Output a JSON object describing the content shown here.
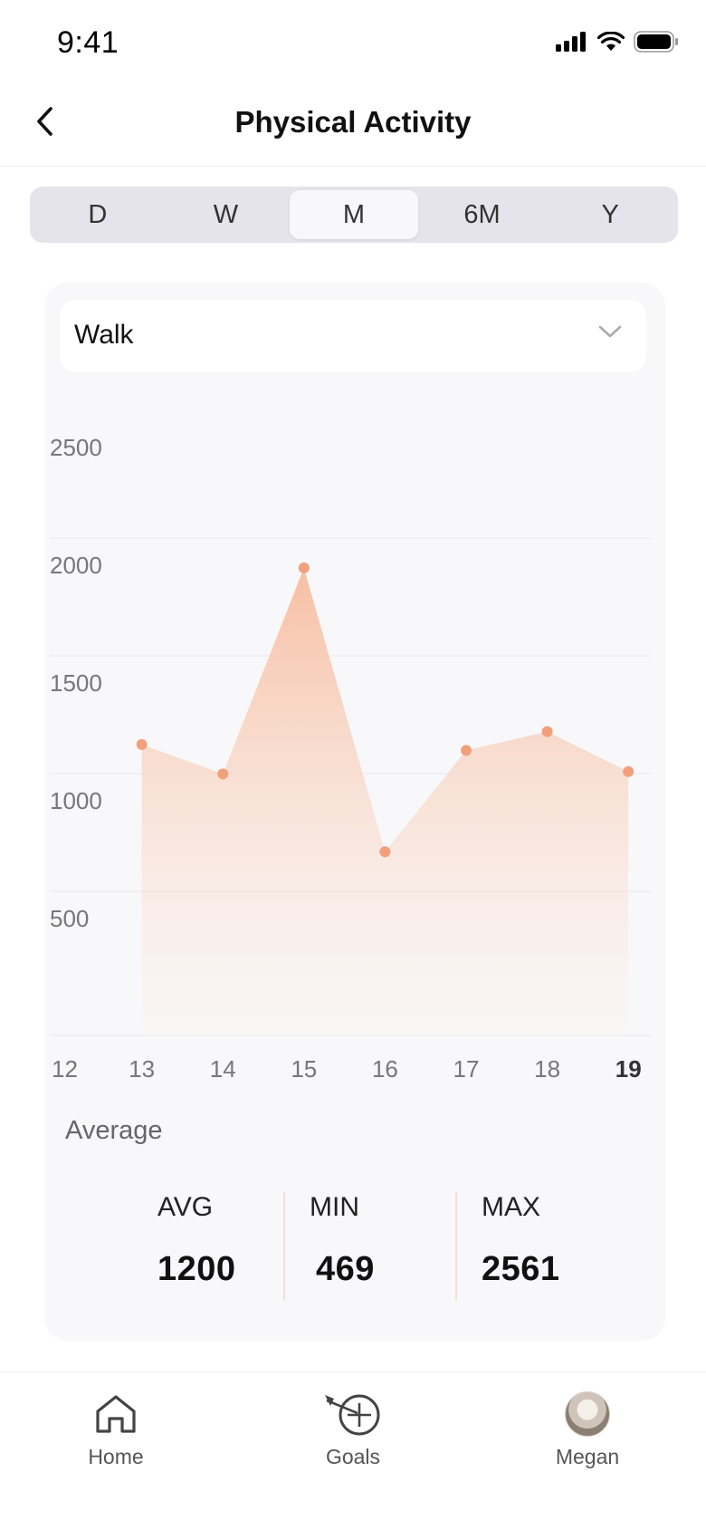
{
  "status": {
    "time": "9:41"
  },
  "header": {
    "title": "Physical Activity"
  },
  "range_tabs": [
    {
      "label": "D",
      "active": false
    },
    {
      "label": "W",
      "active": false
    },
    {
      "label": "M",
      "active": true
    },
    {
      "label": "6M",
      "active": false
    },
    {
      "label": "Y",
      "active": false
    }
  ],
  "activity_select": {
    "value": "Walk"
  },
  "colors": {
    "accent": "#f2a07c",
    "area_top": "#f7bfa3",
    "area_bottom": "#fbf2ee"
  },
  "chart_data": {
    "type": "area",
    "x": [
      "12",
      "13",
      "14",
      "15",
      "16",
      "17",
      "18",
      "19"
    ],
    "highlight_x": "19",
    "y_ticks": [
      "2500",
      "2000",
      "1500",
      "1000",
      "500"
    ],
    "ylim": [
      0,
      2500
    ],
    "grid": true,
    "points": [
      {
        "x": 13,
        "y": 1235
      },
      {
        "x": 14,
        "y": 1110
      },
      {
        "x": 15,
        "y": 1985
      },
      {
        "x": 16,
        "y": 780
      },
      {
        "x": 17,
        "y": 1210
      },
      {
        "x": 18,
        "y": 1290
      },
      {
        "x": 19,
        "y": 1120
      }
    ]
  },
  "stats": {
    "title": "Average",
    "avg": {
      "label": "AVG",
      "value": "1200"
    },
    "min": {
      "label": "MIN",
      "value": "469"
    },
    "max": {
      "label": "MAX",
      "value": "2561"
    }
  },
  "tab_bar": [
    {
      "label": "Home",
      "icon": "home-icon"
    },
    {
      "label": "Goals",
      "icon": "target-icon"
    },
    {
      "label": "Megan",
      "icon": "avatar"
    }
  ]
}
